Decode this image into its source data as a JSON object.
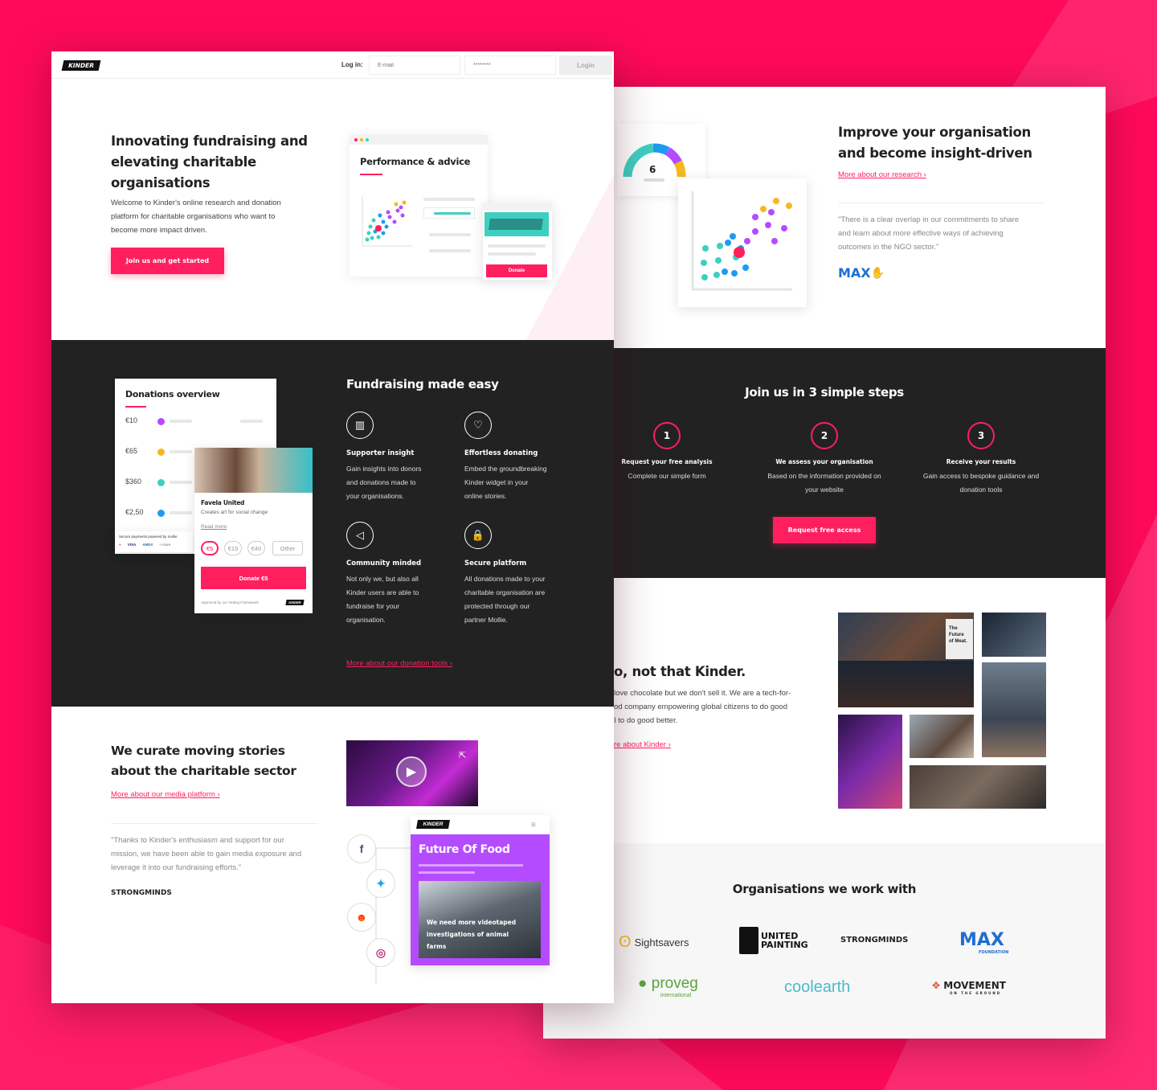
{
  "brand": "KINDER",
  "login": {
    "label": "Log in:",
    "email_placeholder": "E-mail",
    "password_placeholder": "********",
    "button": "Login"
  },
  "hero": {
    "title_lines": [
      "Innovating fundraising and",
      "elevating charitable",
      "organisations"
    ],
    "desc_lines": [
      "Welcome to Kinder's online research and donation",
      "platform for charitable organisations who want to",
      "become more impact driven."
    ],
    "cta": "Join us and get started",
    "card_title": "Performance & advice",
    "donate": "Donate"
  },
  "fundraising": {
    "title": "Fundraising made easy",
    "overview": {
      "title": "Donations overview",
      "amounts": [
        "€10",
        "€65",
        "$360",
        "€2,50"
      ],
      "org": "Favela United",
      "org_desc": "Creates art for social change",
      "read_more": "Read more",
      "chips": [
        "€5",
        "€15",
        "€40",
        "Other"
      ],
      "donate_button": "Donate €5",
      "secure": "Secure payments powered by mollie",
      "cards": [
        "VISA",
        "AMEX",
        "+ more"
      ],
      "approved": "Approved by our Vetting Framework"
    },
    "features": [
      {
        "title": "Supporter insight",
        "lines": [
          "Gain insights into donors",
          "and donations made to",
          "your organisations."
        ]
      },
      {
        "title": "Effortless donating",
        "lines": [
          "Embed the groundbreaking",
          "Kinder widget in your",
          "online stories."
        ]
      },
      {
        "title": "Community minded",
        "lines": [
          "Not only we, but also all",
          "Kinder users are able to",
          "fundraise for your",
          "organisation."
        ]
      },
      {
        "title": "Secure platform",
        "lines": [
          "All donations made to your",
          "charitable organisation are",
          "protected through our",
          "partner Mollie."
        ]
      }
    ],
    "link": "More about our donation tools"
  },
  "stories": {
    "title_lines": [
      "We curate moving stories",
      "about the charitable sector"
    ],
    "link": "More about our media platform",
    "quote_lines": [
      "\"Thanks to Kinder's enthusiasm and support for our",
      "mission, we have been able to gain media exposure and",
      "leverage it into our fundraising efforts.\""
    ],
    "quote_logo": "STRONGMINDS",
    "phone_title": "Future Of Food",
    "phone_caption_lines": [
      "We need more videotaped",
      "investigations of animal",
      "farms"
    ]
  },
  "research": {
    "title_lines": [
      "Improve your organisation",
      "and become insight-driven"
    ],
    "link": "More about our research",
    "quote_lines": [
      "\"There is a clear overlap in our commitments to share",
      "and learn about more effective ways of achieving",
      "outcomes in the NGO sector.\""
    ],
    "quote_logo": "MAX"
  },
  "steps": {
    "title": "Join us in 3 simple steps",
    "items": [
      {
        "num": "1",
        "title": "Request your free analysis",
        "lines": [
          "Complete our simple form"
        ]
      },
      {
        "num": "2",
        "title": "We assess your organisation",
        "lines": [
          "Based on the information provided on",
          "your website"
        ]
      },
      {
        "num": "3",
        "title": "Receive your results",
        "lines": [
          "Gain access to bespoke guidance and",
          "donation tools"
        ]
      }
    ],
    "cta": "Request free access"
  },
  "about": {
    "title": "o, not that Kinder.",
    "lines": [
      "love chocolate but we don't sell it. We are a tech-for-",
      "od company empowering global citizens to do good",
      "I to do good better."
    ],
    "link": "re about Kinder",
    "poster": [
      "The",
      "Future",
      "of Meat."
    ]
  },
  "orgs": {
    "title": "Organisations we work with",
    "logos": [
      "Sightsavers",
      "UNITED PAINTING",
      "STRONGMINDS",
      "MAX",
      "proveg",
      "coolearth",
      "MOVEMENT"
    ],
    "logo_subs": {
      "proveg": "international",
      "max": "FOUNDATION",
      "movement": "ON THE GROUND"
    }
  },
  "colors": {
    "accent": "#ff1f5f",
    "dark": "#222222",
    "purple": "#b44bff",
    "teal": "#3ecfc1",
    "blue": "#1e9bf0",
    "yellow": "#f5b820"
  }
}
